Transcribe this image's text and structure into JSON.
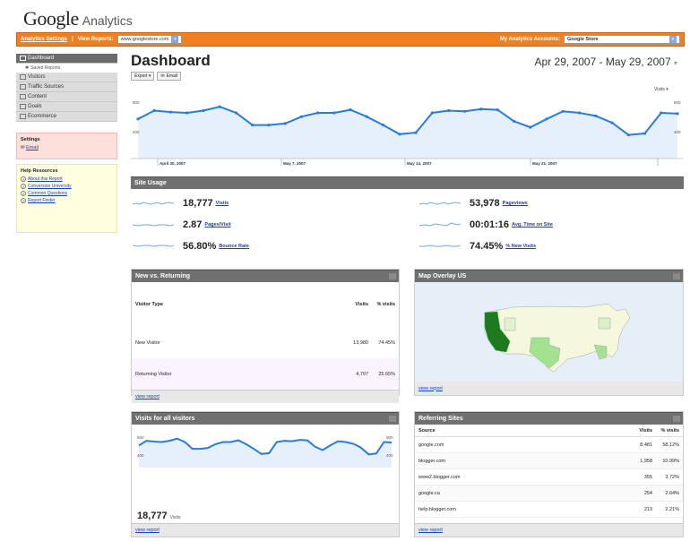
{
  "header": {
    "logo_google": "Google",
    "logo_analytics": "Analytics",
    "analytics_settings": "Analytics Settings",
    "view_reports": "View Reports:",
    "site": "www.googlestore.com",
    "my_accounts": "My Analytics Accounts:",
    "account": "Google Store"
  },
  "sidebar": {
    "items": [
      {
        "label": "Dashboard",
        "icon": "dashboard-icon"
      },
      {
        "label": "Saved Reports",
        "icon": "star-icon"
      },
      {
        "label": "Visitors",
        "icon": "visitors-icon"
      },
      {
        "label": "Traffic Sources",
        "icon": "traffic-icon"
      },
      {
        "label": "Content",
        "icon": "content-icon"
      },
      {
        "label": "Goals",
        "icon": "flag-icon"
      },
      {
        "label": "Ecommerce",
        "icon": "cart-icon"
      }
    ],
    "settings": {
      "title": "Settings",
      "email": "Email"
    },
    "help": {
      "title": "Help Resources",
      "links": [
        "About this Report",
        "Conversion University",
        "Common Questions",
        "Report Finder"
      ]
    }
  },
  "main": {
    "title": "Dashboard",
    "export": "Export ▾",
    "email": "Email",
    "date_range": "Apr 29, 2007 - May 29, 2007",
    "metric_select": "Visits ▾",
    "axis_labels": [
      "April 30, 2007",
      "May 7, 2007",
      "May 14, 2007",
      "May 21, 2007"
    ],
    "y_left": [
      "800",
      "400"
    ],
    "y_right": [
      "800",
      "400"
    ]
  },
  "site_usage": {
    "title": "Site Usage",
    "metrics": [
      {
        "value": "18,777",
        "label": "Visits"
      },
      {
        "value": "2.87",
        "label": "Pages/Visit"
      },
      {
        "value": "56.80%",
        "label": "Bounce Rate"
      },
      {
        "value": "53,978",
        "label": "Pageviews"
      },
      {
        "value": "00:01:16",
        "label": "Avg. Time on Site"
      },
      {
        "value": "74.45%",
        "label": "% New Visits"
      }
    ]
  },
  "new_vs_returning": {
    "title": "New vs. Returning",
    "headers": [
      "Visitor Type",
      "Visits",
      "% visits"
    ],
    "rows": [
      [
        "New Visitor",
        "13,980",
        "74.45%"
      ],
      [
        "Returning Visitor",
        "4,797",
        "25.55%"
      ]
    ],
    "view_report": "view report"
  },
  "map": {
    "title": "Map Overlay US",
    "view_report": "view report"
  },
  "visits_all": {
    "title": "Visits for all visitors",
    "value": "18,777",
    "label": "Visits",
    "y_left": [
      "800",
      "400"
    ],
    "y_right": [
      "800",
      "400"
    ],
    "view_report": "view report"
  },
  "referring": {
    "title": "Referring Sites",
    "headers": [
      "Source",
      "Visits",
      "% visits"
    ],
    "rows": [
      [
        "google.com",
        "8,481",
        "58.12%"
      ],
      [
        "blogger.com",
        "1,958",
        "10.99%"
      ],
      [
        "www2.blogger.com",
        "355",
        "3.72%"
      ],
      [
        "google.ca",
        "254",
        "2.64%"
      ],
      [
        "help.blogger.com",
        "213",
        "2.21%"
      ]
    ],
    "view_report": "view report"
  },
  "chart_data": {
    "type": "line",
    "x": [
      1,
      2,
      3,
      4,
      5,
      6,
      7,
      8,
      9,
      10,
      11,
      12,
      13,
      14,
      15,
      16,
      17,
      18,
      19,
      20,
      21,
      22,
      23,
      24,
      25,
      26,
      27,
      28,
      29,
      30,
      31
    ],
    "series": [
      {
        "values": [
          720,
          830,
          810,
          800,
          830,
          880,
          800,
          640,
          640,
          660,
          750,
          800,
          800,
          840,
          750,
          640,
          520,
          540,
          800,
          830,
          820,
          850,
          840,
          690,
          610,
          720,
          820,
          800,
          760,
          670,
          510,
          530,
          800,
          790
        ]
      }
    ],
    "ylim": [
      200,
      1000
    ],
    "color": "#2b7bdc",
    "fill": "#e5f0fb"
  }
}
